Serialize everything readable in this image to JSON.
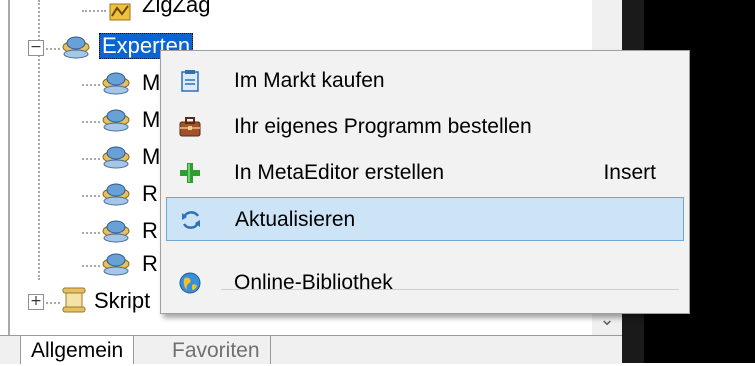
{
  "tree": {
    "items": [
      {
        "label": "ZigZag"
      },
      {
        "label": "Experten"
      },
      {
        "label": "M"
      },
      {
        "label": "M"
      },
      {
        "label": "M"
      },
      {
        "label": "R"
      },
      {
        "label": "R"
      },
      {
        "label": "R"
      },
      {
        "label": "Skript"
      }
    ],
    "expanders": {
      "collapse": "−",
      "expand": "+"
    }
  },
  "scrollbar": {
    "down_arrow": "⌄"
  },
  "tabs": [
    {
      "label": "Allgemein"
    },
    {
      "label": "Favoriten"
    }
  ],
  "context_menu": {
    "items": [
      {
        "label": "Im Markt kaufen",
        "icon": "market-bag-icon"
      },
      {
        "label": "Ihr eigenes Programm bestellen",
        "icon": "briefcase-icon"
      },
      {
        "label": "In MetaEditor erstellen",
        "shortcut": "Insert",
        "icon": "green-plus-icon"
      },
      {
        "label": "Aktualisieren",
        "icon": "refresh-icon",
        "highlighted": true
      },
      {
        "label": "Online-Bibliothek",
        "icon": "globe-icon"
      }
    ]
  },
  "colors": {
    "selection": "#0a64d2",
    "menu_highlight": "#cde4f7"
  }
}
